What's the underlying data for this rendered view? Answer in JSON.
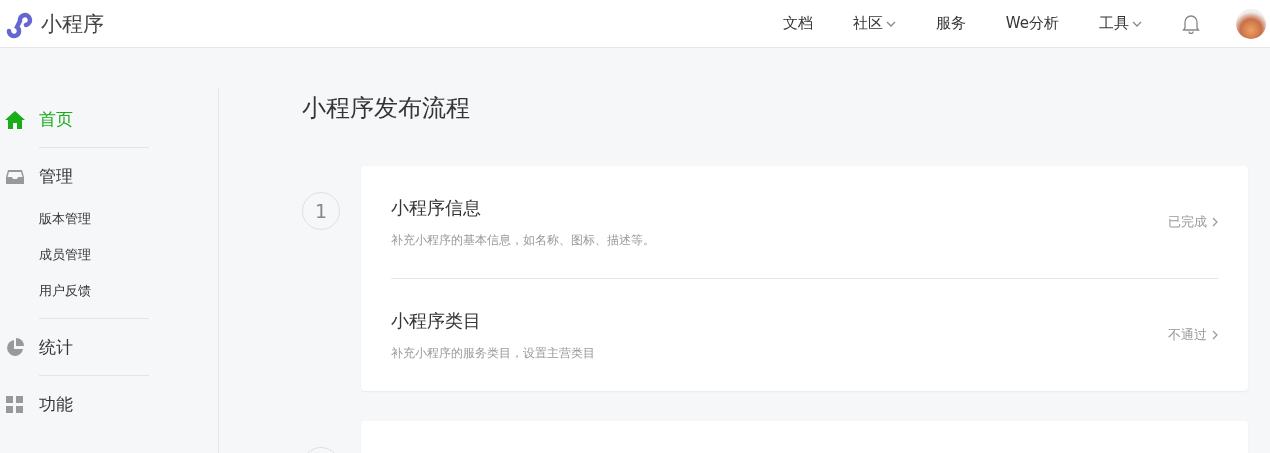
{
  "header": {
    "brand": "小程序",
    "nav": [
      {
        "label": "文档",
        "dropdown": false
      },
      {
        "label": "社区",
        "dropdown": true
      },
      {
        "label": "服务",
        "dropdown": false
      },
      {
        "label": "We分析",
        "dropdown": false
      },
      {
        "label": "工具",
        "dropdown": true
      }
    ]
  },
  "sidebar": {
    "sections": [
      {
        "label": "首页",
        "selected": true
      },
      {
        "label": "管理",
        "selected": false,
        "children": [
          {
            "label": "版本管理"
          },
          {
            "label": "成员管理"
          },
          {
            "label": "用户反馈"
          }
        ]
      },
      {
        "label": "统计",
        "selected": false
      },
      {
        "label": "功能",
        "selected": false
      }
    ]
  },
  "page": {
    "title": "小程序发布流程",
    "steps": [
      {
        "number": "1",
        "rows": [
          {
            "title": "小程序信息",
            "description": "补充小程序的基本信息，如名称、图标、描述等。",
            "status": "已完成"
          },
          {
            "title": "小程序类目",
            "description": "补充小程序的服务类目，设置主营类目",
            "status": "不通过"
          }
        ]
      }
    ]
  }
}
